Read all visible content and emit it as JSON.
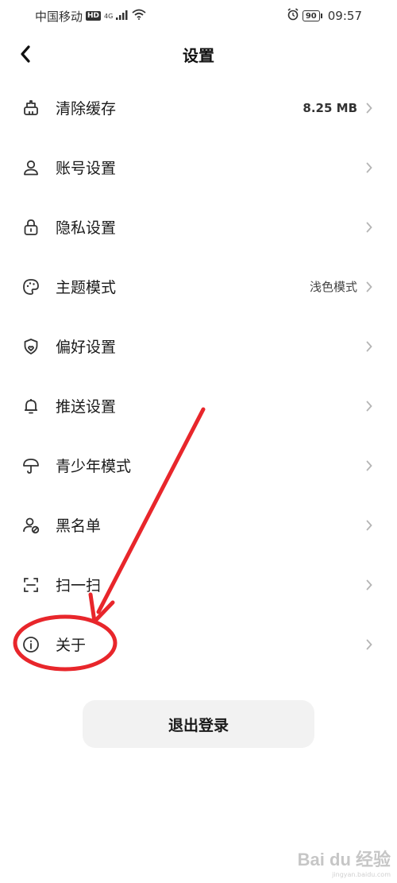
{
  "status_bar": {
    "carrier": "中国移动",
    "hd": "HD",
    "network": "4G",
    "battery": "90",
    "time": "09:57"
  },
  "header": {
    "title": "设置"
  },
  "settings": [
    {
      "label": "清除缓存",
      "value": "8.25 MB",
      "icon": "broom-icon"
    },
    {
      "label": "账号设置",
      "value": "",
      "icon": "user-icon"
    },
    {
      "label": "隐私设置",
      "value": "",
      "icon": "lock-icon"
    },
    {
      "label": "主题模式",
      "value": "浅色模式",
      "icon": "palette-icon"
    },
    {
      "label": "偏好设置",
      "value": "",
      "icon": "shield-heart-icon"
    },
    {
      "label": "推送设置",
      "value": "",
      "icon": "bell-icon"
    },
    {
      "label": "青少年模式",
      "value": "",
      "icon": "umbrella-icon"
    },
    {
      "label": "黑名单",
      "value": "",
      "icon": "user-block-icon"
    },
    {
      "label": "扫一扫",
      "value": "",
      "icon": "scan-icon"
    },
    {
      "label": "关于",
      "value": "",
      "icon": "info-icon"
    }
  ],
  "logout": {
    "label": "退出登录"
  },
  "watermark": {
    "logo": "Bai du 经验",
    "sub": "jingyan.baidu.com"
  },
  "colors": {
    "annotation": "#e8262b",
    "chevron": "#b5b5b5"
  }
}
